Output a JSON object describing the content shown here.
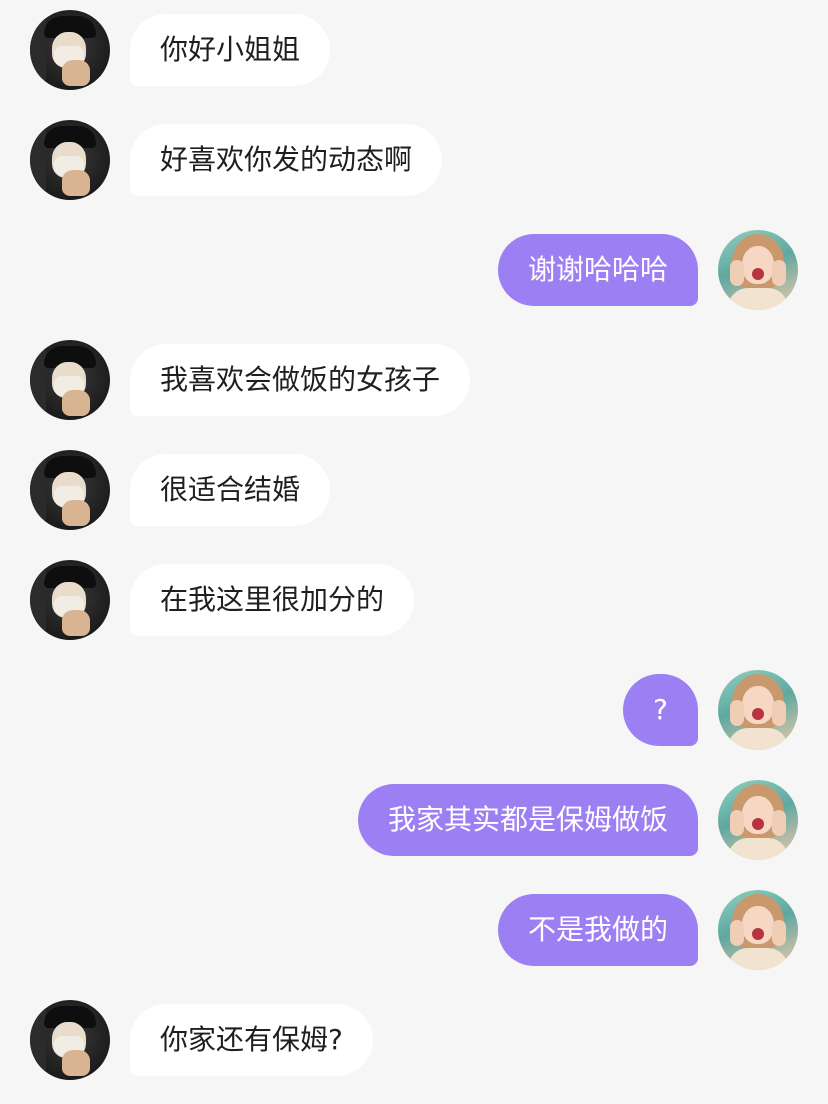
{
  "messages": [
    {
      "side": "left",
      "text": "你好小姐姐"
    },
    {
      "side": "left",
      "text": "好喜欢你发的动态啊"
    },
    {
      "side": "right",
      "text": "谢谢哈哈哈"
    },
    {
      "side": "left",
      "text": "我喜欢会做饭的女孩子"
    },
    {
      "side": "left",
      "text": "很适合结婚"
    },
    {
      "side": "left",
      "text": "在我这里很加分的"
    },
    {
      "side": "right",
      "text": "?"
    },
    {
      "side": "right",
      "text": "我家其实都是保姆做饭"
    },
    {
      "side": "right",
      "text": "不是我做的"
    },
    {
      "side": "left",
      "text": "你家还有保姆?"
    }
  ],
  "colors": {
    "background": "#f6f6f6",
    "incoming_bubble": "#ffffff",
    "outgoing_bubble": "#9d7ff4",
    "incoming_text": "#1f1f1f",
    "outgoing_text": "#ffffff"
  }
}
